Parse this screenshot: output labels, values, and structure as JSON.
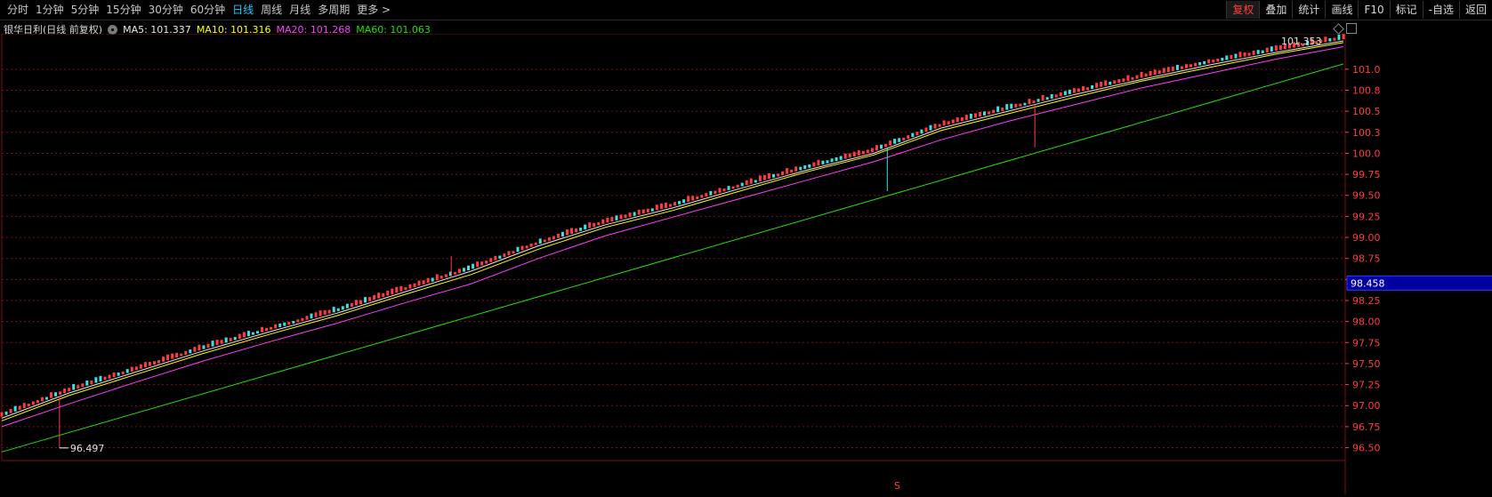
{
  "toolbar": {
    "tabs": [
      "分时",
      "1分钟",
      "5分钟",
      "15分钟",
      "30分钟",
      "60分钟",
      "日线",
      "周线",
      "月线",
      "多周期",
      "更多 >"
    ],
    "active_tab": "日线",
    "right_buttons": [
      "复权",
      "叠加",
      "统计",
      "画线",
      "F10",
      "标记",
      "-自选",
      "返回"
    ],
    "active_right": "复权"
  },
  "info": {
    "stock_name": "银华日利(日线 前复权)",
    "ma5": "MA5: 101.337",
    "ma10": "MA10: 101.316",
    "ma20": "MA20: 101.268",
    "ma60": "MA60: 101.063"
  },
  "colors": {
    "ma5": "#e8e8e8",
    "ma10": "#ffff00",
    "ma20": "#ff3cff",
    "ma60": "#22e000",
    "up": "#ff3d3d",
    "down": "#40e0e0",
    "grid": "#7a1010",
    "axis_text": "#ff3d3d"
  },
  "chart_data": {
    "type": "line",
    "ylim": [
      96.4,
      101.4
    ],
    "y_ticks": [
      "101.0",
      "100.8",
      "100.5",
      "100.3",
      "100.0",
      "99.75",
      "99.50",
      "99.25",
      "99.00",
      "98.75",
      "98.50",
      "98.25",
      "98.00",
      "97.75",
      "97.50",
      "97.25",
      "97.00",
      "96.75",
      "96.50"
    ],
    "tick_values": [
      101.0,
      100.75,
      100.5,
      100.25,
      100.0,
      99.75,
      99.5,
      99.25,
      99.0,
      98.75,
      98.5,
      98.25,
      98.0,
      97.75,
      97.5,
      97.25,
      97.0,
      96.75,
      96.5
    ],
    "crosshair_value": "98.458",
    "high_label": "101.353",
    "low_label": "96.497",
    "s_marker": "S",
    "series": [
      {
        "name": "MA5",
        "x": [
          0,
          0.05,
          0.1,
          0.15,
          0.2,
          0.25,
          0.3,
          0.35,
          0.4,
          0.45,
          0.5,
          0.55,
          0.6,
          0.65,
          0.7,
          0.75,
          0.8,
          0.85,
          0.9,
          0.95,
          1.0
        ],
        "values": [
          96.85,
          97.15,
          97.4,
          97.65,
          97.88,
          98.1,
          98.35,
          98.6,
          98.9,
          99.15,
          99.35,
          99.58,
          99.8,
          100.0,
          100.3,
          100.5,
          100.7,
          100.88,
          101.05,
          101.2,
          101.337
        ]
      },
      {
        "name": "MA10",
        "x": [
          0,
          0.05,
          0.1,
          0.15,
          0.2,
          0.25,
          0.3,
          0.35,
          0.4,
          0.45,
          0.5,
          0.55,
          0.6,
          0.65,
          0.7,
          0.75,
          0.8,
          0.85,
          0.9,
          0.95,
          1.0
        ],
        "values": [
          96.82,
          97.12,
          97.37,
          97.62,
          97.85,
          98.07,
          98.32,
          98.56,
          98.86,
          99.12,
          99.32,
          99.55,
          99.78,
          99.98,
          100.27,
          100.47,
          100.67,
          100.86,
          101.02,
          101.18,
          101.316
        ]
      },
      {
        "name": "MA20",
        "x": [
          0,
          0.05,
          0.1,
          0.15,
          0.2,
          0.25,
          0.3,
          0.35,
          0.4,
          0.45,
          0.5,
          0.55,
          0.6,
          0.65,
          0.7,
          0.75,
          0.8,
          0.85,
          0.9,
          0.95,
          1.0
        ],
        "values": [
          96.75,
          97.02,
          97.28,
          97.53,
          97.76,
          97.98,
          98.22,
          98.45,
          98.75,
          99.02,
          99.24,
          99.46,
          99.68,
          99.9,
          100.16,
          100.38,
          100.58,
          100.78,
          100.95,
          101.12,
          101.268
        ]
      },
      {
        "name": "MA60",
        "x": [
          0,
          1.0
        ],
        "values": [
          96.45,
          101.063
        ]
      }
    ]
  }
}
